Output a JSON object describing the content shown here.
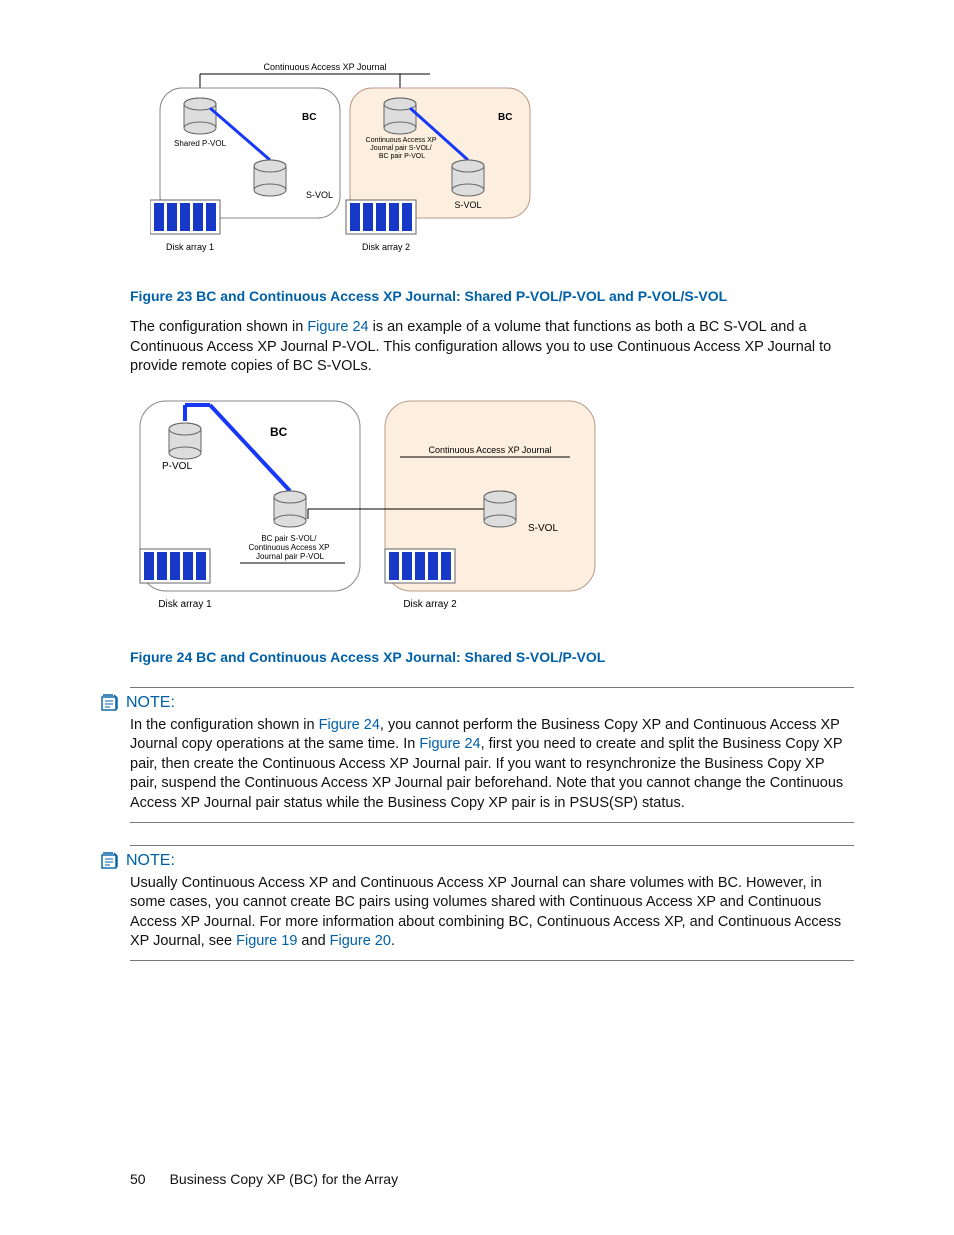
{
  "figure23": {
    "topLabel": "Continuous Access XP Journal",
    "left": {
      "bc": "BC",
      "pvol": "Shared P-VOL",
      "svol": "S-VOL",
      "array": "Disk array 1"
    },
    "right": {
      "bc": "BC",
      "midLabel": "Continuous Access XP\nJournal pair S-VOL/\nBC pair P-VOL",
      "svol": "S-VOL",
      "array": "Disk array 2"
    },
    "caption": "Figure 23 BC and Continuous Access XP Journal: Shared P-VOL/P-VOL and P-VOL/S-VOL"
  },
  "para1": {
    "a": "The configuration shown in ",
    "link": "Figure 24",
    "b": " is an example of a volume that functions as both a BC S-VOL and a Continuous Access XP Journal P-VOL. This configuration allows you to use Continuous Access XP Journal to provide remote copies of BC S-VOLs."
  },
  "figure24": {
    "left": {
      "bc": "BC",
      "pvol": "P-VOL",
      "midLabel": "BC pair S-VOL/\nContinuous Access XP\nJournal pair P-VOL",
      "array": "Disk array 1"
    },
    "right": {
      "topLabel": "Continuous Access XP Journal",
      "svol": "S-VOL",
      "array": "Disk array 2"
    },
    "caption": "Figure 24 BC and Continuous Access XP Journal: Shared S-VOL/P-VOL"
  },
  "note1": {
    "heading": "NOTE:",
    "a": "In the configuration shown in ",
    "link1": "Figure 24",
    "b": ", you cannot perform the Business Copy XP and Continuous Access XP Journal copy operations at the same time. In ",
    "link2": "Figure 24",
    "c": ", first you need to create and split the Business Copy XP pair, then create the Continuous Access XP Journal pair. If you want to resynchronize the Business Copy XP pair, suspend the Continuous Access XP Journal pair beforehand. Note that you cannot change the Continuous Access XP Journal pair status while the Business Copy XP pair is in PSUS(SP) status."
  },
  "note2": {
    "heading": "NOTE:",
    "a": "Usually Continuous Access XP and Continuous Access XP Journal can share volumes with BC. However, in some cases, you cannot create BC pairs using volumes shared with Continuous Access XP and Continuous Access XP Journal. For more information about combining BC, Continuous Access XP, and Continuous Access XP Journal, see ",
    "link1": "Figure 19",
    "mid": " and ",
    "link2": "Figure 20",
    "end": "."
  },
  "footer": {
    "page": "50",
    "title": "Business Copy XP (BC) for the Array"
  }
}
